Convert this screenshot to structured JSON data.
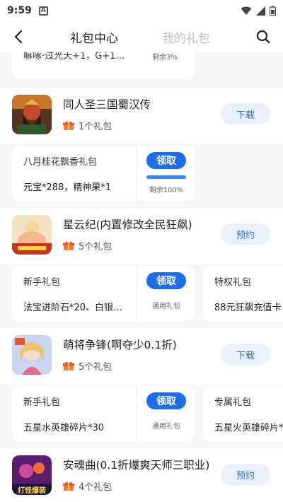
{
  "status_bar": {
    "time": "9:59",
    "notification_letter": "A"
  },
  "nav": {
    "tab_active": "礼包中心",
    "tab_inactive": "我的礼包"
  },
  "partial_top": {
    "text": "嘛啄·过光天+1，G+1…",
    "remaining": "剩余3%"
  },
  "games": [
    {
      "title": "同人圣三国蜀汉传",
      "gift_count": "1个礼包",
      "button": "下载",
      "icon": "guan-yu-portrait-icon",
      "packs": [
        {
          "name": "八月桂花飘香礼包",
          "desc": "元宝*288，精神果*1",
          "claim": "领取",
          "sub": "剩余100%",
          "progress": 100
        }
      ]
    },
    {
      "title": "星云纪(内置修改全民狂飙)",
      "gift_count": "5个礼包",
      "button": "预约",
      "icon": "fairy-game-icon",
      "packs": [
        {
          "name": "新手礼包",
          "desc": "法宝进阶石*20、白银…",
          "claim": "领取",
          "sub": "通用礼包"
        },
        {
          "name": "特权礼包",
          "desc": "88元狂飙充值卡"
        }
      ]
    },
    {
      "title": "萌将争锋(啊夺少0.1折)",
      "gift_count": "5个礼包",
      "button": "下载",
      "icon": "anime-girl-icon",
      "packs": [
        {
          "name": "新手礼包",
          "desc": "五星水英雄碎片*30",
          "claim": "领取",
          "sub": "通用礼包"
        },
        {
          "name": "专属礼包",
          "desc": "五星火英雄碎片*"
        }
      ]
    },
    {
      "title": "安魂曲(0.1折爆爽天师三职业)",
      "gift_count": "4个礼包",
      "button": "预约",
      "icon": "game-poster-icon",
      "icon_text": "打怪爆装",
      "packs": []
    }
  ],
  "colors": {
    "accent": "#1e6ee8",
    "button_bg": "#e9f1fd",
    "page_bg": "#f5f6f8"
  }
}
